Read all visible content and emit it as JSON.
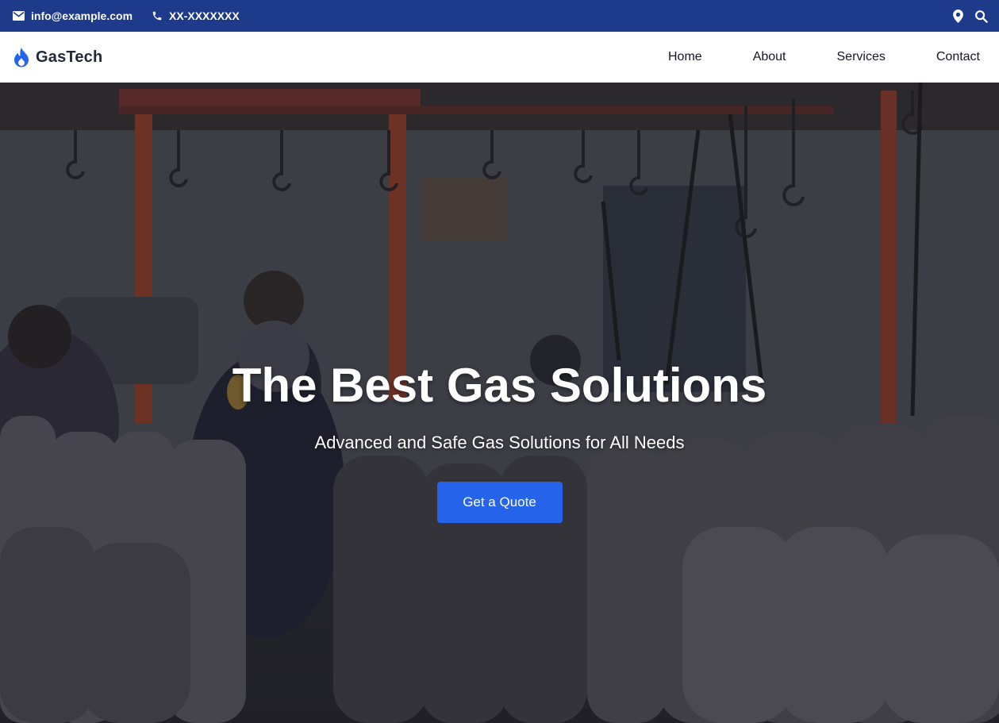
{
  "colors": {
    "topbar_bg": "#1e3a8a",
    "brand_icon": "#2563eb",
    "cta_bg": "#2563eb",
    "nav_text": "#111827"
  },
  "topbar": {
    "email": {
      "icon": "envelope-icon",
      "text": "info@example.com"
    },
    "phone": {
      "icon": "phone-icon",
      "text": "XX-XXXXXXX"
    },
    "right_icons": [
      "map-pin-icon",
      "search-icon"
    ]
  },
  "brand": {
    "icon": "flame-icon",
    "name": "GasTech"
  },
  "nav": {
    "items": [
      {
        "label": "Home"
      },
      {
        "label": "About"
      },
      {
        "label": "Services"
      },
      {
        "label": "Contact"
      }
    ]
  },
  "hero": {
    "title": "The Best Gas Solutions",
    "subtitle": "Advanced and Safe Gas Solutions for All Needs",
    "cta_label": "Get a Quote"
  }
}
